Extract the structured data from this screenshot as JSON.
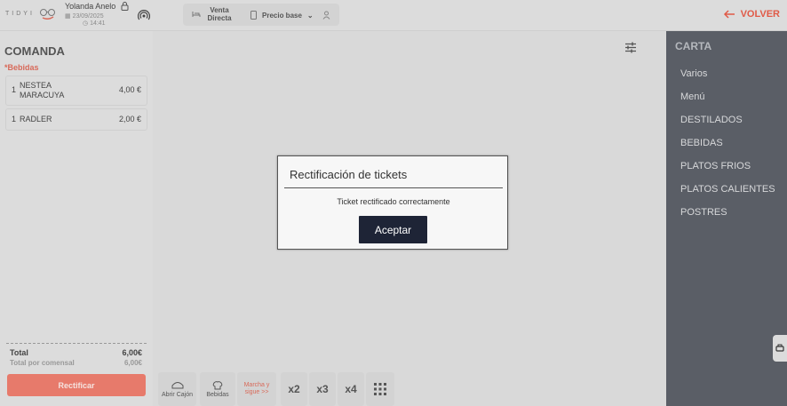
{
  "header": {
    "logo_text": "TIDYI",
    "user_name": "Yolanda Anelo",
    "date": "23/09/2025",
    "time": "14:41",
    "mode_label": "Venta Directa",
    "price_label": "Precio base",
    "back_label": "VOLVER"
  },
  "comanda": {
    "title": "COMANDA",
    "category": "*Bebidas",
    "items": [
      {
        "qty": "1",
        "name": "NESTEA MARACUYA",
        "price": "4,00 €"
      },
      {
        "qty": "1",
        "name": "RADLER",
        "price": "2,00 €"
      }
    ],
    "total_label": "Total",
    "total_value": "6,00€",
    "per_diner_label": "Total por comensal",
    "per_diner_value": "6,00€",
    "rectify_button": "Rectificar"
  },
  "toolbar": {
    "open_drawer": "Abrir Cajón",
    "drinks": "Bebidas",
    "marcha": "Marcha y sigue >>",
    "x2": "x2",
    "x3": "x3",
    "x4": "x4"
  },
  "carta": {
    "title": "CARTA",
    "items": [
      "Varios",
      "Menú",
      "DESTILADOS",
      "BEBIDAS",
      "PLATOS FRIOS",
      "PLATOS CALIENTES",
      "POSTRES"
    ]
  },
  "dialog": {
    "title": "Rectificación de tickets",
    "message": "Ticket rectificado correctamente",
    "accept": "Aceptar"
  },
  "colors": {
    "accent": "#e05a47",
    "carta_bg": "#5a5e66",
    "dialog_button": "#1e2436"
  }
}
